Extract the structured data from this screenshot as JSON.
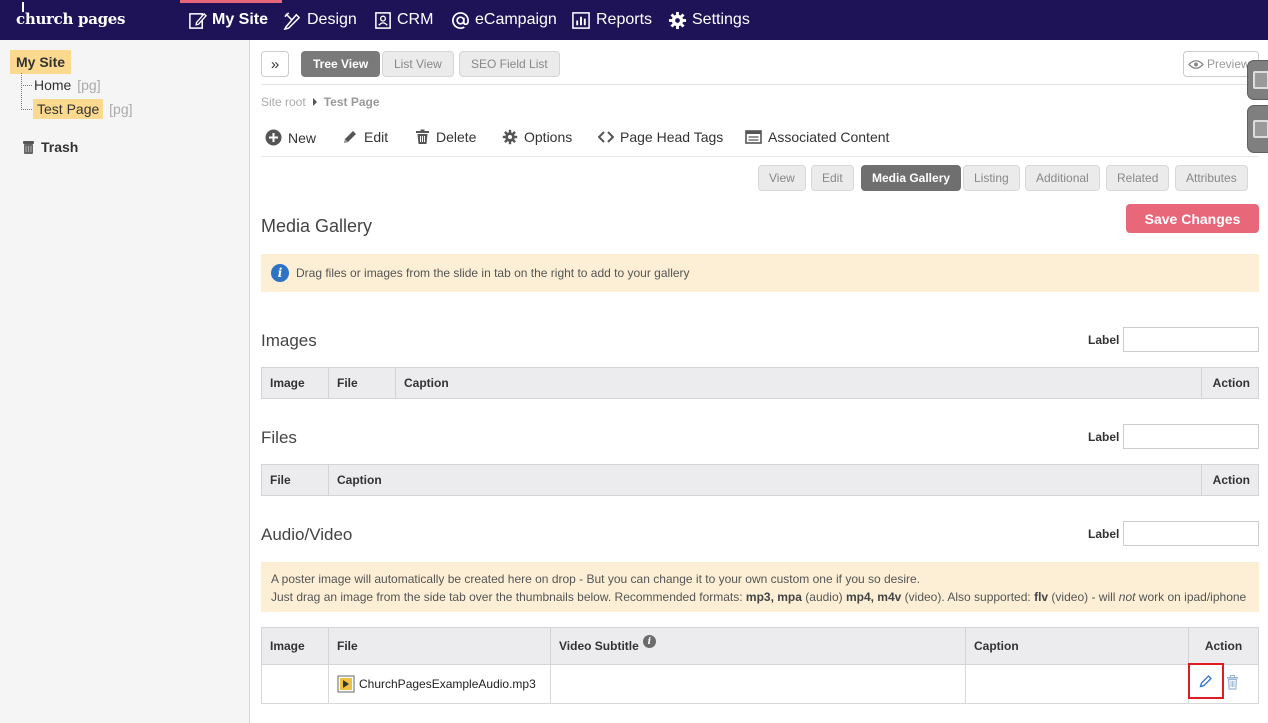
{
  "nav": {
    "logo": "church pages",
    "items": [
      {
        "label": "My Site",
        "icon": "edit-icon"
      },
      {
        "label": "Design",
        "icon": "design-icon"
      },
      {
        "label": "CRM",
        "icon": "crm-icon"
      },
      {
        "label": "eCampaign",
        "icon": "at-icon"
      },
      {
        "label": "Reports",
        "icon": "reports-icon"
      },
      {
        "label": "Settings",
        "icon": "gear-icon"
      }
    ]
  },
  "sidebar": {
    "root": "My Site",
    "items": [
      {
        "label": "Home",
        "tag": "[pg]"
      },
      {
        "label": "Test Page",
        "tag": "[pg]"
      }
    ],
    "trash": "Trash"
  },
  "toolbar": {
    "collapse_glyph": "»",
    "views": [
      "Tree View",
      "List View",
      "SEO Field List"
    ],
    "preview": "Preview"
  },
  "breadcrumb": {
    "root": "Site root",
    "current": "Test Page"
  },
  "actions": [
    "New",
    "Edit",
    "Delete",
    "Options",
    "Page Head Tags",
    "Associated Content"
  ],
  "subtabs": [
    "View",
    "Edit",
    "Media Gallery",
    "Listing",
    "Additional",
    "Related",
    "Attributes"
  ],
  "page": {
    "title": "Media Gallery",
    "save_label": "Save Changes",
    "info": "Drag files or images from the slide in tab on the right to add to your gallery"
  },
  "sections": {
    "label_text": "Label",
    "images": {
      "title": "Images",
      "columns": [
        "Image",
        "File",
        "Caption",
        "Action"
      ]
    },
    "files": {
      "title": "Files",
      "columns": [
        "File",
        "Caption",
        "Action"
      ]
    },
    "audio": {
      "title": "Audio/Video",
      "notice_line1": "A poster image will automatically be created here on drop - But you can change it to your own custom one if you so desire.",
      "notice_line2_a": "Just drag an image from the side tab over the thumbnails below. Recommended formats: ",
      "fmt1": "mp3, mpa",
      "t1": " (audio) ",
      "fmt2": "mp4, m4v",
      "t2": " (video). Also supported: ",
      "fmt3": "flv",
      "t3": " (video) - will ",
      "not": "not",
      "t4": " work on ipad/iphone",
      "columns": [
        "Image",
        "File",
        "Video Subtitle",
        "Caption",
        "Action"
      ],
      "rows": [
        {
          "image": "",
          "file": "ChurchPagesExampleAudio.mp3",
          "subtitle": "",
          "caption": ""
        }
      ]
    }
  },
  "colors": {
    "nav_bg": "#1e1356",
    "accent": "#e8687a",
    "highlight": "#fbd98e",
    "notice_bg": "#fcefd6"
  }
}
